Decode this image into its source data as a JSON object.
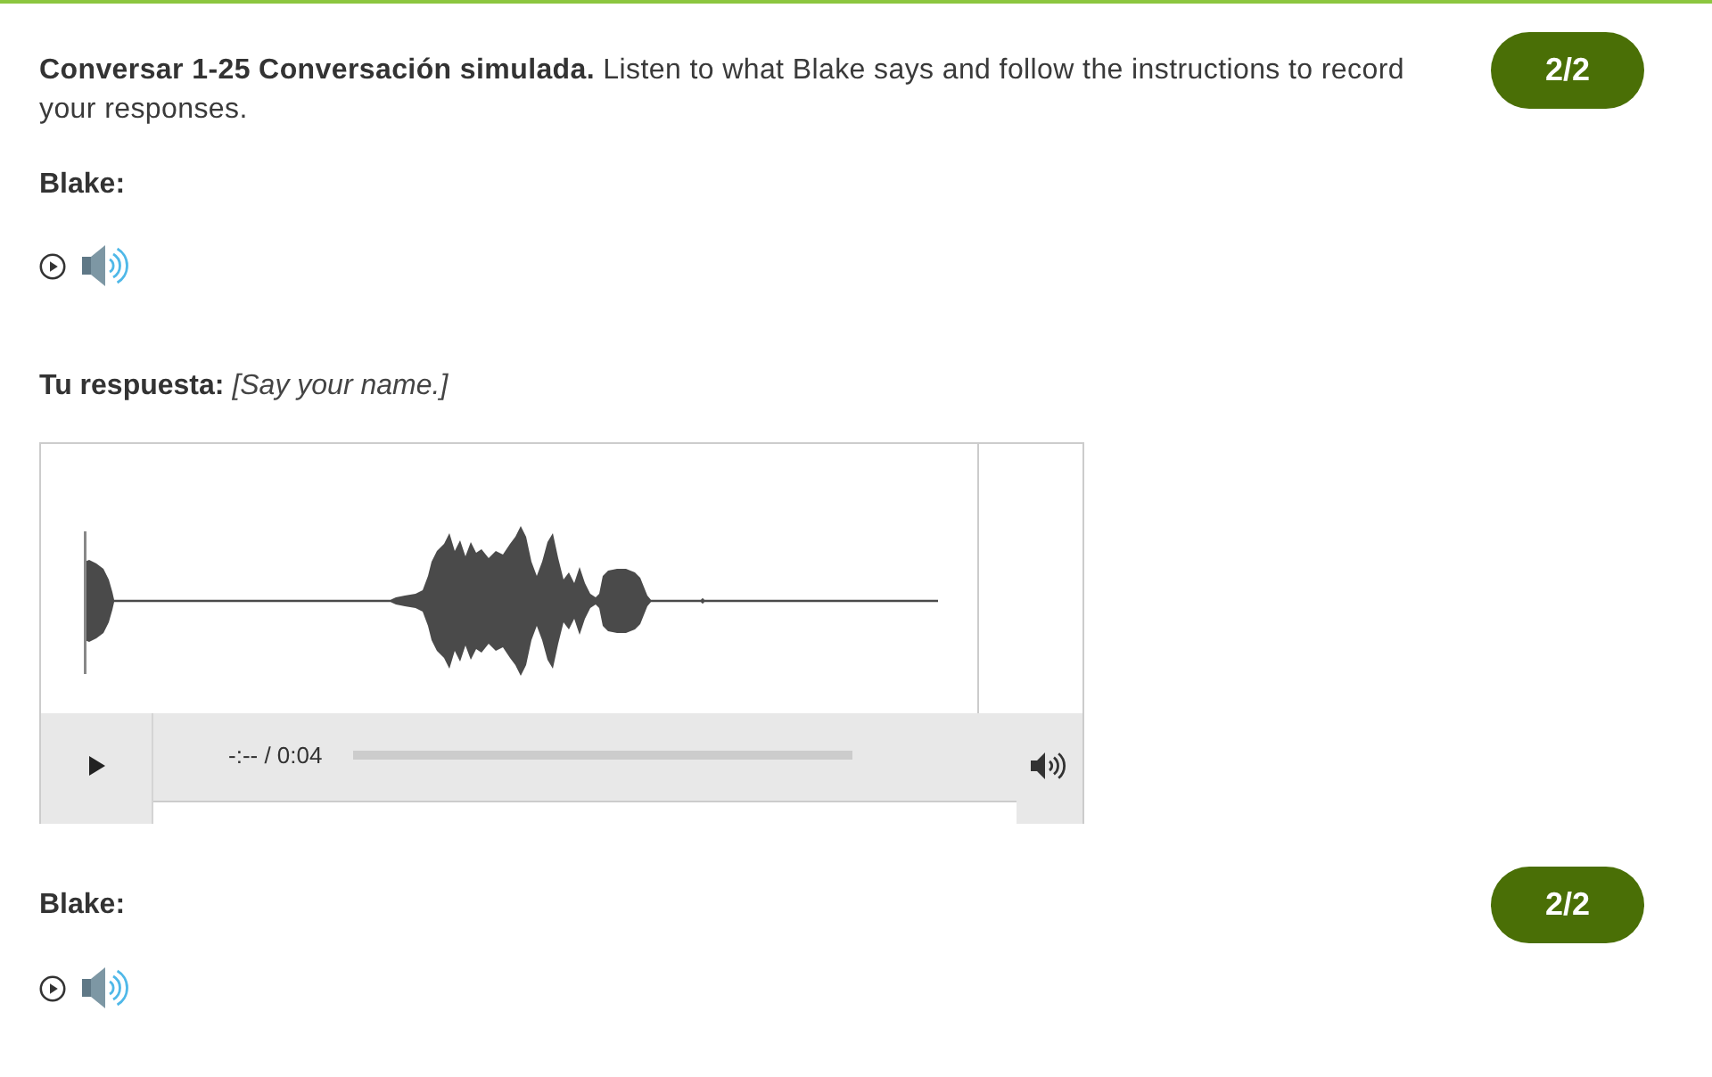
{
  "header": {
    "text": "**Conversar 1-25 Conversación simulada.** Listen to what Blake says and follow the instructions to record your responses.",
    "score": "2/2"
  },
  "items": [
    {
      "kind": "prompt",
      "speaker": "Blake:"
    },
    {
      "kind": "response",
      "prompt": "**Tu respuesta:** *[Say your name.]*",
      "player": {
        "time": "-:-- / 0:04"
      }
    },
    {
      "kind": "prompt",
      "speaker": "Blake:",
      "score": "2/2"
    }
  ]
}
